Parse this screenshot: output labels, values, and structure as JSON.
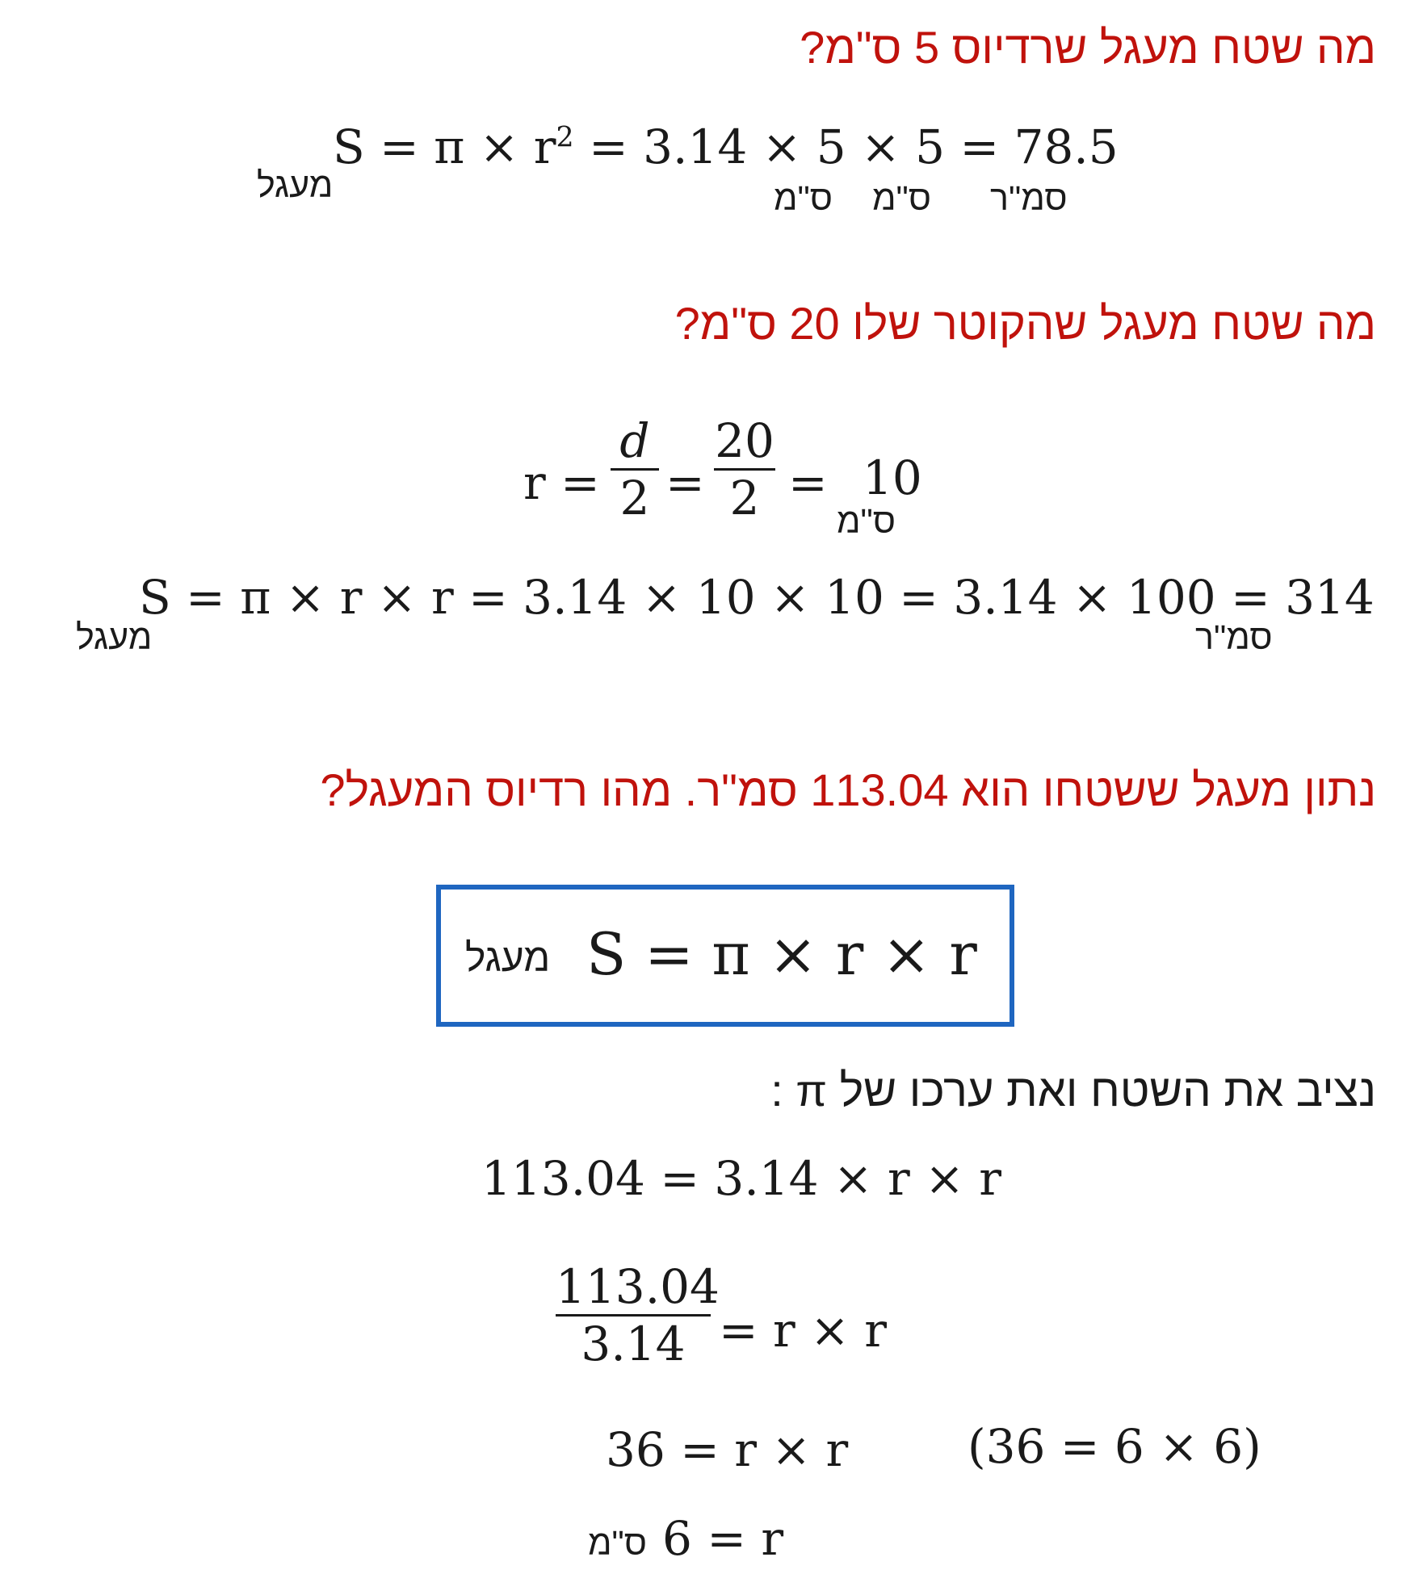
{
  "colors": {
    "question": "#c0120c",
    "box_border": "#1f66c0",
    "text": "#1a1a1a"
  },
  "q1": {
    "title": "מה שטח מעגל שרדיוס 5 ס\"מ?",
    "formula_left": "S = π × r",
    "exp": "2",
    "formula_right": " = 3.14 ×  5 ×  5 =  78.5",
    "sub_circle": "מעגל",
    "unit_cm1": "ס\"מ",
    "unit_cm2": "ס\"מ",
    "unit_sqcm": "סמ\"ר"
  },
  "q2": {
    "title": "מה שטח מעגל שהקוטר שלו 20 ס\"מ?",
    "r_label": "r =",
    "frac1_num": "d",
    "frac1_den": "2",
    "eq1": "=",
    "frac2_num": "20",
    "frac2_den": "2",
    "eq2": "=",
    "result": "10",
    "unit_cm": "ס\"מ",
    "formula": "S = π × r × r = 3.14 × 10 × 10 = 3.14 × 100 =  314",
    "sub_circle": "מעגל",
    "unit_sqcm": "סמ\"ר"
  },
  "q3": {
    "title": "נתון מעגל ששטחו הוא 113.04 סמ\"ר. מהו רדיוס המעגל?",
    "box_sub": "מעגל",
    "box_formula": "S = π × r × r",
    "instruction": "נציב את השטח ואת ערכו של π :",
    "step1": "113.04 = 3.14 × r × r",
    "frac_num": "113.04",
    "frac_den": "3.14",
    "frac_rhs": "= r × r",
    "step3": "36 = r × r",
    "step3_note": "(36 = 6 × 6)",
    "final_unit": "ס\"מ",
    "final": "6 = r"
  }
}
